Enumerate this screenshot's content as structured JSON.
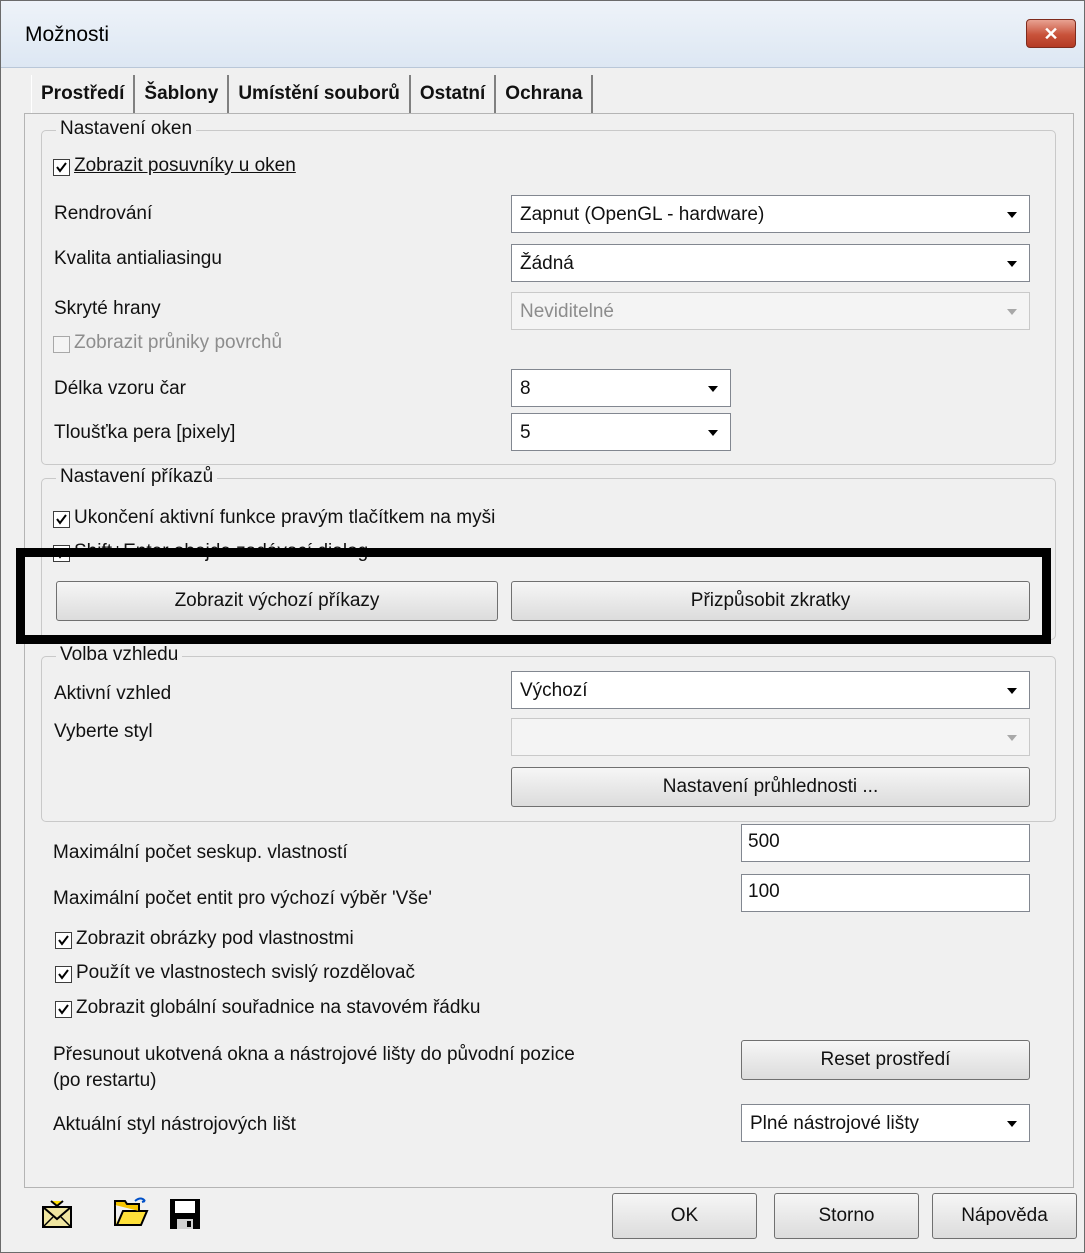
{
  "window": {
    "title": "Možnosti"
  },
  "tabs": [
    "Prostředí",
    "Šablony",
    "Umístění souborů",
    "Ostatní",
    "Ochrana"
  ],
  "window_settings": {
    "title": "Nastavení oken",
    "show_scrollbars": {
      "label": "Zobrazit posuvníky u oken",
      "checked": true
    },
    "rendering": {
      "label": "Rendrování",
      "value": "Zapnut (OpenGL - hardware)"
    },
    "antialiasing": {
      "label": "Kvalita antialiasingu",
      "value": "Žádná"
    },
    "hidden_edges": {
      "label": "Skryté hrany",
      "value": "Neviditelné",
      "disabled": true
    },
    "show_intersections": {
      "label": "Zobrazit průniky povrchů",
      "checked": false,
      "disabled": true
    },
    "line_pattern_length": {
      "label": "Délka vzoru čar",
      "value": "8"
    },
    "pen_thickness": {
      "label": "Tloušťka pera [pixely]",
      "value": "5"
    }
  },
  "command_settings": {
    "title": "Nastavení příkazů",
    "right_click_end": {
      "label": "Ukončení aktivní funkce pravým tlačítkem na myši",
      "checked": true
    },
    "shift_enter": {
      "label": "Shift+Enter obejde zadávací dialog",
      "checked": true
    },
    "show_default_commands": "Zobrazit výchozí příkazy",
    "customize_shortcuts": "Přizpůsobit zkratky"
  },
  "appearance": {
    "title": "Volba vzhledu",
    "active_look": {
      "label": "Aktivní vzhled",
      "value": "Výchozí"
    },
    "choose_style": {
      "label": "Vyberte styl",
      "value": ""
    },
    "transparency_button": "Nastavení průhlednosti ..."
  },
  "misc": {
    "max_grouped_props": {
      "label": "Maximální počet seskup. vlastností",
      "value": "500"
    },
    "max_entities_all": {
      "label": "Maximální počet entit pro výchozí výběr  'Vše'",
      "value": "100"
    },
    "show_images": {
      "label": "Zobrazit obrázky pod vlastnostmi",
      "checked": true
    },
    "vertical_splitter": {
      "label": "Použít ve vlastnostech svislý rozdělovač",
      "checked": true
    },
    "global_coords": {
      "label": "Zobrazit globální souřadnice na stavovém řádku",
      "checked": true
    },
    "reset_text_line1": "Přesunout ukotvená okna a nástrojové lišty do původní pozice",
    "reset_text_line2": "(po restartu)",
    "reset_button": "Reset prostředí",
    "toolbar_style": {
      "label": "Aktuální styl nástrojových lišt",
      "value": "Plné nástrojové lišty"
    }
  },
  "footer": {
    "ok": "OK",
    "cancel": "Storno",
    "help": "Nápověda"
  },
  "icons": [
    "mail-icon",
    "open-folder-icon",
    "save-disk-icon"
  ],
  "colors": {
    "close_button": "#c8523a",
    "highlight_frame": "#000000"
  }
}
